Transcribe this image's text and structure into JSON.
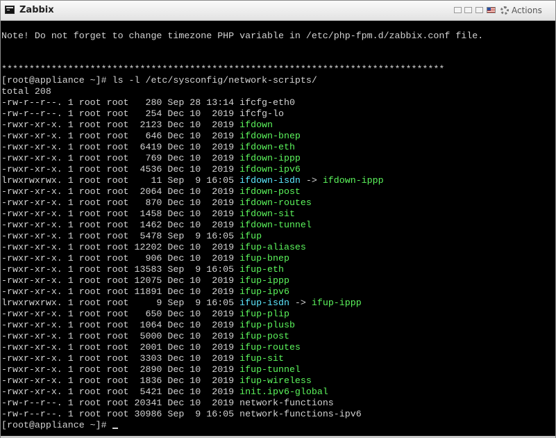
{
  "window": {
    "title": "Zabbix",
    "actions_label": "Actions"
  },
  "terminal": {
    "notice": "Note! Do not forget to change timezone PHP variable in /etc/php-fpm.d/zabbix.conf file.",
    "separator": "********************************************************************************",
    "command": "[root@appliance ~]# ls -l /etc/sysconfig/network-scripts/",
    "total": "total 208",
    "prompt": "[root@appliance ~]# ",
    "entries": [
      {
        "meta": "-rw-r--r--. 1 root root   280 Sep 28 13:14 ",
        "name": "ifcfg-eth0",
        "color": "default",
        "target": ""
      },
      {
        "meta": "-rw-r--r--. 1 root root   254 Dec 10  2019 ",
        "name": "ifcfg-lo",
        "color": "default",
        "target": ""
      },
      {
        "meta": "-rwxr-xr-x. 1 root root  2123 Dec 10  2019 ",
        "name": "ifdown",
        "color": "exec",
        "target": ""
      },
      {
        "meta": "-rwxr-xr-x. 1 root root   646 Dec 10  2019 ",
        "name": "ifdown-bnep",
        "color": "exec",
        "target": ""
      },
      {
        "meta": "-rwxr-xr-x. 1 root root  6419 Dec 10  2019 ",
        "name": "ifdown-eth",
        "color": "exec",
        "target": ""
      },
      {
        "meta": "-rwxr-xr-x. 1 root root   769 Dec 10  2019 ",
        "name": "ifdown-ippp",
        "color": "exec",
        "target": ""
      },
      {
        "meta": "-rwxr-xr-x. 1 root root  4536 Dec 10  2019 ",
        "name": "ifdown-ipv6",
        "color": "exec",
        "target": ""
      },
      {
        "meta": "lrwxrwxrwx. 1 root root    11 Sep  9 16:05 ",
        "name": "ifdown-isdn",
        "color": "link",
        "target": "ifdown-ippp"
      },
      {
        "meta": "-rwxr-xr-x. 1 root root  2064 Dec 10  2019 ",
        "name": "ifdown-post",
        "color": "exec",
        "target": ""
      },
      {
        "meta": "-rwxr-xr-x. 1 root root   870 Dec 10  2019 ",
        "name": "ifdown-routes",
        "color": "exec",
        "target": ""
      },
      {
        "meta": "-rwxr-xr-x. 1 root root  1458 Dec 10  2019 ",
        "name": "ifdown-sit",
        "color": "exec",
        "target": ""
      },
      {
        "meta": "-rwxr-xr-x. 1 root root  1462 Dec 10  2019 ",
        "name": "ifdown-tunnel",
        "color": "exec",
        "target": ""
      },
      {
        "meta": "-rwxr-xr-x. 1 root root  5478 Sep  9 16:05 ",
        "name": "ifup",
        "color": "exec",
        "target": ""
      },
      {
        "meta": "-rwxr-xr-x. 1 root root 12202 Dec 10  2019 ",
        "name": "ifup-aliases",
        "color": "exec",
        "target": ""
      },
      {
        "meta": "-rwxr-xr-x. 1 root root   906 Dec 10  2019 ",
        "name": "ifup-bnep",
        "color": "exec",
        "target": ""
      },
      {
        "meta": "-rwxr-xr-x. 1 root root 13583 Sep  9 16:05 ",
        "name": "ifup-eth",
        "color": "exec",
        "target": ""
      },
      {
        "meta": "-rwxr-xr-x. 1 root root 12075 Dec 10  2019 ",
        "name": "ifup-ippp",
        "color": "exec",
        "target": ""
      },
      {
        "meta": "-rwxr-xr-x. 1 root root 11891 Dec 10  2019 ",
        "name": "ifup-ipv6",
        "color": "exec",
        "target": ""
      },
      {
        "meta": "lrwxrwxrwx. 1 root root     9 Sep  9 16:05 ",
        "name": "ifup-isdn",
        "color": "link",
        "target": "ifup-ippp"
      },
      {
        "meta": "-rwxr-xr-x. 1 root root   650 Dec 10  2019 ",
        "name": "ifup-plip",
        "color": "exec",
        "target": ""
      },
      {
        "meta": "-rwxr-xr-x. 1 root root  1064 Dec 10  2019 ",
        "name": "ifup-plusb",
        "color": "exec",
        "target": ""
      },
      {
        "meta": "-rwxr-xr-x. 1 root root  5000 Dec 10  2019 ",
        "name": "ifup-post",
        "color": "exec",
        "target": ""
      },
      {
        "meta": "-rwxr-xr-x. 1 root root  2001 Dec 10  2019 ",
        "name": "ifup-routes",
        "color": "exec",
        "target": ""
      },
      {
        "meta": "-rwxr-xr-x. 1 root root  3303 Dec 10  2019 ",
        "name": "ifup-sit",
        "color": "exec",
        "target": ""
      },
      {
        "meta": "-rwxr-xr-x. 1 root root  2890 Dec 10  2019 ",
        "name": "ifup-tunnel",
        "color": "exec",
        "target": ""
      },
      {
        "meta": "-rwxr-xr-x. 1 root root  1836 Dec 10  2019 ",
        "name": "ifup-wireless",
        "color": "exec",
        "target": ""
      },
      {
        "meta": "-rwxr-xr-x. 1 root root  5421 Dec 10  2019 ",
        "name": "init.ipv6-global",
        "color": "exec",
        "target": ""
      },
      {
        "meta": "-rw-r--r--. 1 root root 20341 Dec 10  2019 ",
        "name": "network-functions",
        "color": "default",
        "target": ""
      },
      {
        "meta": "-rw-r--r--. 1 root root 30986 Sep  9 16:05 ",
        "name": "network-functions-ipv6",
        "color": "default",
        "target": ""
      }
    ]
  },
  "colors": {
    "default": "#d3d3d3",
    "exec": "#5cf55c",
    "link": "#5ce8ff",
    "background": "#000000"
  }
}
